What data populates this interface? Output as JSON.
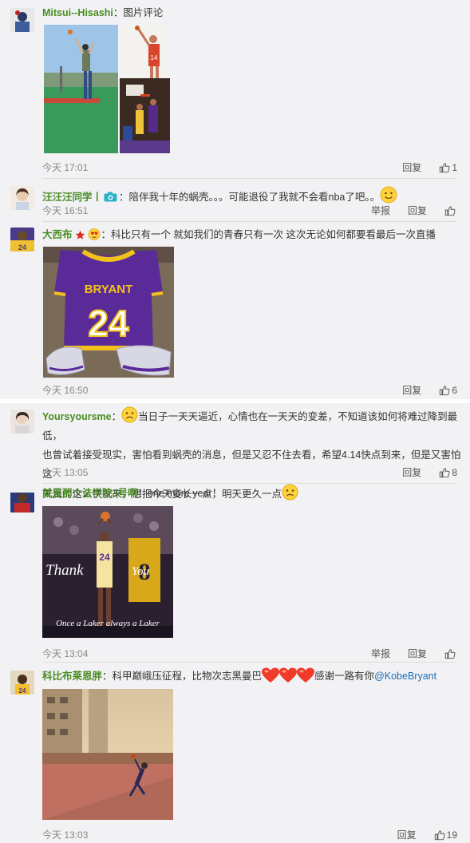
{
  "comments": [
    {
      "user": "Mitsui--Hisashi",
      "sep": "：",
      "text": "图片评论",
      "time": "今天 17:01",
      "reply": "回复",
      "likes": "1"
    },
    {
      "user": "汪汪汪同学丨",
      "sep": "：",
      "text": "陪伴我十年的蜗壳。。。可能退役了我就不会看nba了吧。。",
      "time": "今天 16:51",
      "report": "举报",
      "reply": "回复"
    },
    {
      "user": "大西布",
      "sep": "：",
      "text": "科比只有一个 就如我们的青春只有一次 这次无论如何都要看最后一次直播",
      "time": "今天 16:50",
      "reply": "回复",
      "likes": "6",
      "jersey_name": "BRYANT",
      "jersey_number": "24"
    },
    {
      "user": "Yoursyoursme",
      "sep": "：",
      "text_a": "当日子一天天逼近，心情也在一天天的变差，不知道该如何将难过降到最低，",
      "text_b": "也曾试着接受现实，害怕看到蜗壳的消息，但是又忍不住去看，希望4.14快点到来，但是又害怕这",
      "text_c": "天真的这么快就来，想把今天变长一点，明天更久一点",
      "time": "今天 13:05",
      "reply": "回复",
      "likes": "8"
    },
    {
      "user": "就是那个法学院3号啊",
      "sep": "：",
      "text": "one more year！",
      "time": "今天 13:04",
      "report": "举报",
      "reply": "回复",
      "poster_left": "Thank",
      "poster_right": "You",
      "poster_bottom": "Once a Laker always a Laker",
      "poster_number": "24"
    },
    {
      "user": "科比布莱恩胖",
      "sep": "：",
      "text": "科甲巅峨压征程，比物次志黑曼巴",
      "text_after": "感谢一路有你",
      "mention": "@KobeBryant",
      "time": "今天 13:03",
      "reply": "回复",
      "likes": "19"
    }
  ],
  "icons": {
    "like": "thumbs-up-icon",
    "smile": "smile-emoji-icon",
    "sad": "sad-emoji-icon",
    "heart": "heart-emoji-icon",
    "camera": "camera-badge-icon",
    "star": "star-badge-icon"
  },
  "colors": {
    "username": "#4a8c22",
    "mention": "#1a6fb5",
    "meta": "#888888",
    "background": "#f2f2f5"
  }
}
